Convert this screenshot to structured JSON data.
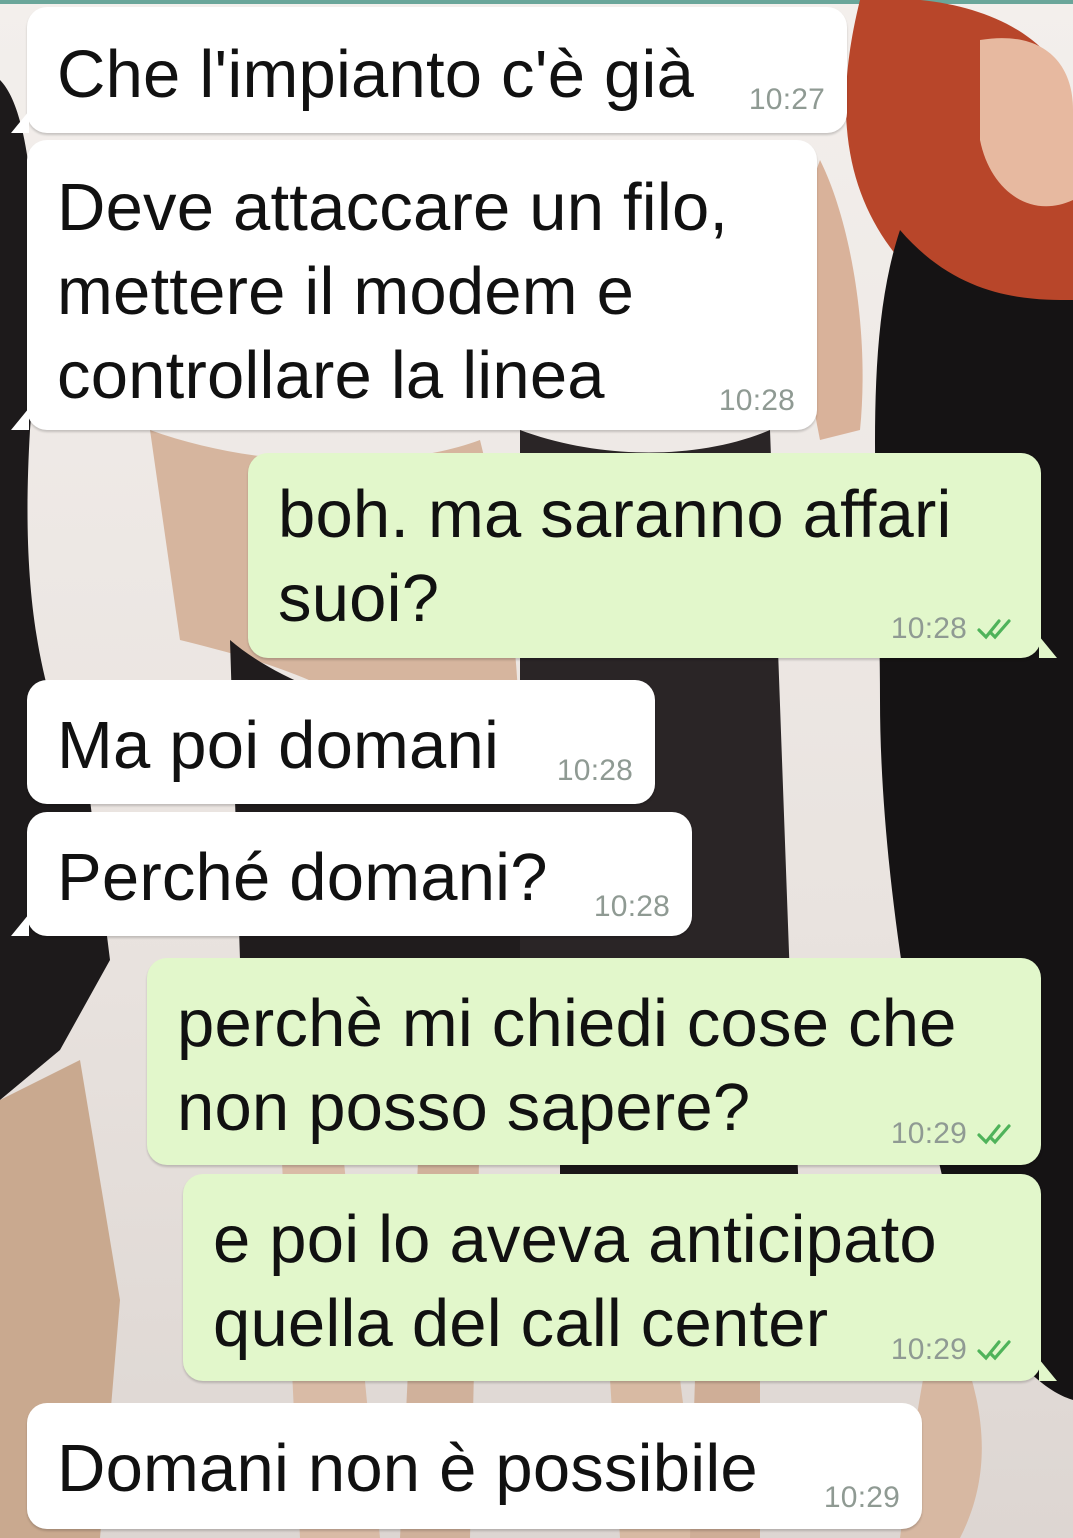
{
  "messages": [
    {
      "direction": "in",
      "lines": [
        "Che l'impianto c'è già"
      ],
      "time": "10:27"
    },
    {
      "direction": "in",
      "lines": [
        "Deve attaccare un filo,",
        "mettere il modem e",
        "controllare la linea"
      ],
      "time": "10:28"
    },
    {
      "direction": "out",
      "lines": [
        "boh. ma saranno affari",
        "suoi?"
      ],
      "time": "10:28",
      "status": "read"
    },
    {
      "direction": "in",
      "lines": [
        "Ma poi domani"
      ],
      "time": "10:28"
    },
    {
      "direction": "in",
      "lines": [
        "Perché domani?"
      ],
      "time": "10:28"
    },
    {
      "direction": "out",
      "lines": [
        "perchè mi chiedi cose che",
        "non posso sapere?"
      ],
      "time": "10:29",
      "status": "read"
    },
    {
      "direction": "out",
      "lines": [
        "e poi lo aveva anticipato",
        "quella del call center"
      ],
      "time": "10:29",
      "status": "read"
    },
    {
      "direction": "in",
      "lines": [
        "Domani non è possibile"
      ],
      "time": "10:29"
    }
  ],
  "colors": {
    "incoming_bubble": "#ffffff",
    "outgoing_bubble": "#e2f7cb",
    "timestamp": "#8f9a93",
    "read_ticks": "#4fb35a"
  },
  "icons": {
    "read_receipt": "double-check-icon"
  }
}
